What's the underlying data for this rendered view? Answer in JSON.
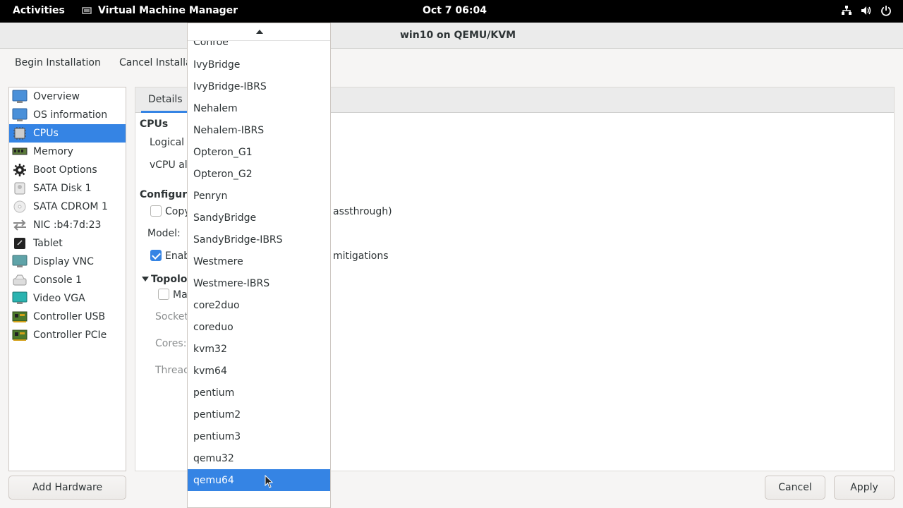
{
  "topbar": {
    "activities": "Activities",
    "app_name": "Virtual Machine Manager",
    "clock": "Oct 7  06:04"
  },
  "window": {
    "title": "win10 on QEMU/KVM"
  },
  "toolbar": {
    "begin_installation": "Begin Installation",
    "cancel_installation": "Cancel Installati"
  },
  "sidebar": {
    "items": [
      {
        "label": "Overview",
        "icon": "monitor-icon"
      },
      {
        "label": "OS information",
        "icon": "monitor-icon"
      },
      {
        "label": "CPUs",
        "icon": "cpu-chip-icon",
        "selected": true
      },
      {
        "label": "Memory",
        "icon": "memory-icon"
      },
      {
        "label": "Boot Options",
        "icon": "gear-icon"
      },
      {
        "label": "SATA Disk 1",
        "icon": "disk-icon"
      },
      {
        "label": "SATA CDROM 1",
        "icon": "cdrom-icon"
      },
      {
        "label": "NIC :b4:7d:23",
        "icon": "network-arrows-icon"
      },
      {
        "label": "Tablet",
        "icon": "tablet-icon"
      },
      {
        "label": "Display VNC",
        "icon": "display-icon"
      },
      {
        "label": "Console 1",
        "icon": "console-icon"
      },
      {
        "label": "Video VGA",
        "icon": "video-card-icon"
      },
      {
        "label": "Controller USB",
        "icon": "controller-card-icon"
      },
      {
        "label": "Controller PCIe",
        "icon": "controller-card-icon"
      }
    ],
    "add_hardware": "Add Hardware"
  },
  "main": {
    "tab_details": "Details",
    "cpus_heading": "CPUs",
    "logical_host": "Logical h",
    "vcpu_alloc": "vCPU all",
    "configuration_heading": "Configurat",
    "copy_host_label": "Copy",
    "copy_host_suffix": "assthrough)",
    "model_label": "Model:",
    "enable_label": "Enab",
    "enable_suffix": "mitigations",
    "topology_heading": "Topolog",
    "manual_label": "Ma",
    "sockets_label": "Sockets",
    "cores_label": "Cores:",
    "threads_label": "Thread"
  },
  "dropdown": {
    "partial_top": "Conroe",
    "options": [
      "IvyBridge",
      "IvyBridge-IBRS",
      "Nehalem",
      "Nehalem-IBRS",
      "Opteron_G1",
      "Opteron_G2",
      "Penryn",
      "SandyBridge",
      "SandyBridge-IBRS",
      "Westmere",
      "Westmere-IBRS",
      "core2duo",
      "coreduo",
      "kvm32",
      "kvm64",
      "pentium",
      "pentium2",
      "pentium3",
      "qemu32",
      "qemu64"
    ],
    "selected": "qemu64"
  },
  "buttons": {
    "cancel": "Cancel",
    "apply": "Apply"
  },
  "colors": {
    "accent": "#3584e4",
    "topbar": "#000000"
  }
}
